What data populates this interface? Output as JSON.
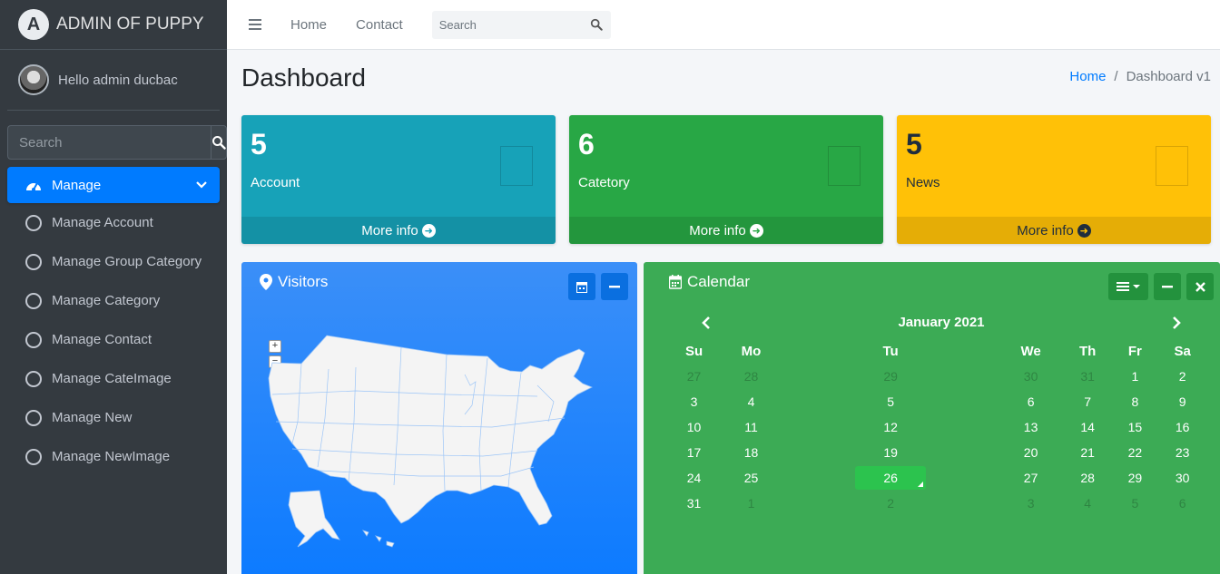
{
  "brand": {
    "logo_letter": "A",
    "title": "ADMIN OF PUPPY"
  },
  "user": {
    "greeting": "Hello admin ducbac"
  },
  "sidebar": {
    "search_placeholder": "Search",
    "active_item": "Manage",
    "items": [
      {
        "label": "Manage Account"
      },
      {
        "label": "Manage Group Category"
      },
      {
        "label": "Manage Category"
      },
      {
        "label": "Manage Contact"
      },
      {
        "label": "Manage CateImage"
      },
      {
        "label": "Manage New"
      },
      {
        "label": "Manage NewImage"
      }
    ]
  },
  "topbar": {
    "links": [
      "Home",
      "Contact"
    ],
    "search_placeholder": "Search"
  },
  "page": {
    "title": "Dashboard",
    "breadcrumb": {
      "home": "Home",
      "sep": "/",
      "current": "Dashboard v1"
    }
  },
  "stats": [
    {
      "value": "5",
      "label": "Account",
      "more": "More info",
      "color": "#17a2b8"
    },
    {
      "value": "6",
      "label": "Catetory",
      "more": "More info",
      "color": "#28a745"
    },
    {
      "value": "5",
      "label": "News",
      "more": "More info",
      "color": "#ffc107"
    }
  ],
  "visitors": {
    "title": "Visitors",
    "zoom_in": "+",
    "zoom_out": "−"
  },
  "calendar": {
    "title": "Calendar",
    "month": "January 2021",
    "weekdays": [
      "Su",
      "Mo",
      "Tu",
      "We",
      "Th",
      "Fr",
      "Sa"
    ],
    "weeks": [
      [
        "27",
        "28",
        "29",
        "30",
        "31",
        "1",
        "2"
      ],
      [
        "3",
        "4",
        "5",
        "6",
        "7",
        "8",
        "9"
      ],
      [
        "10",
        "11",
        "12",
        "13",
        "14",
        "15",
        "16"
      ],
      [
        "17",
        "18",
        "19",
        "20",
        "21",
        "22",
        "23"
      ],
      [
        "24",
        "25",
        "26",
        "27",
        "28",
        "29",
        "30"
      ],
      [
        "31",
        "1",
        "2",
        "3",
        "4",
        "5",
        "6"
      ]
    ],
    "today": "26"
  },
  "colors": {
    "sidebar_bg": "#343a40",
    "primary": "#007bff",
    "info": "#17a2b8",
    "success": "#28a745",
    "warning": "#ffc107"
  }
}
